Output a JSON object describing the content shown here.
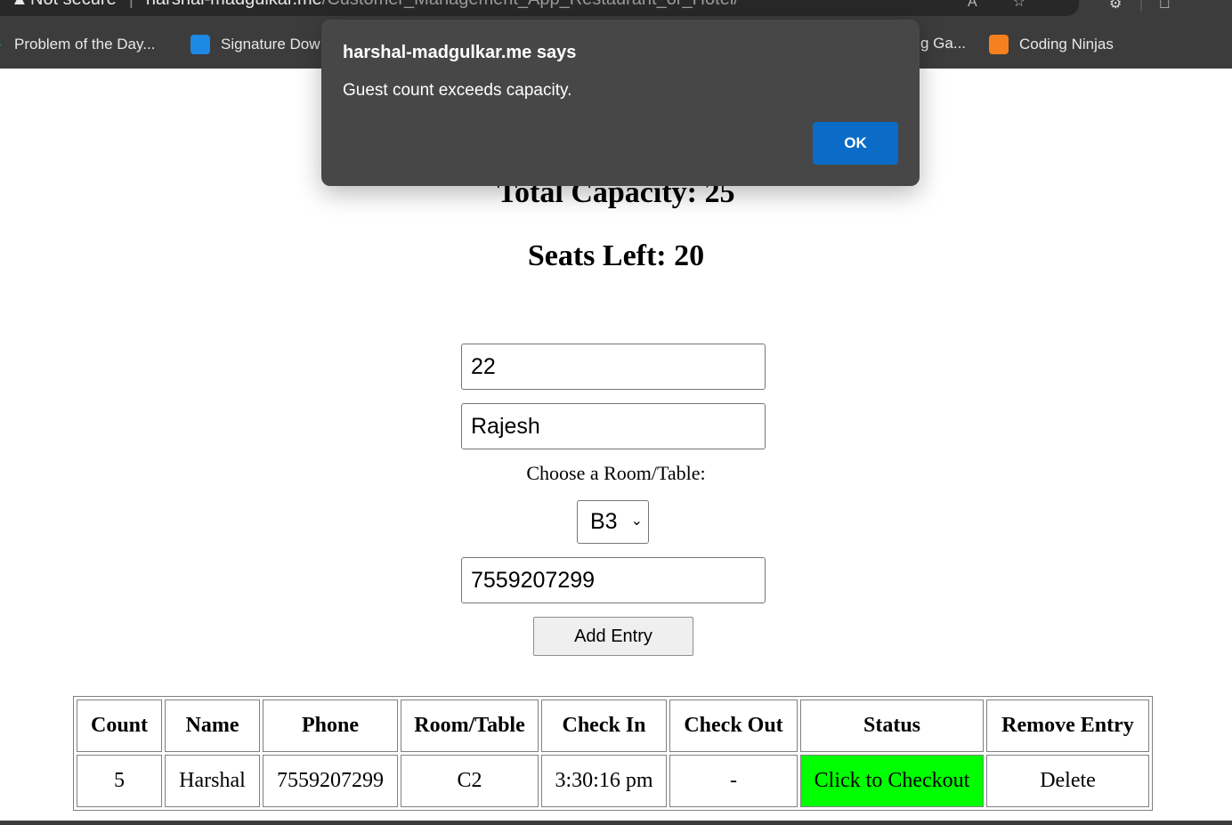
{
  "browser": {
    "security_label": "Not secure",
    "url_host": "harshal-madgulkar.me",
    "url_path": "/Customer_Management_App_Restaurant_or_Hotel/",
    "bookmarks": [
      {
        "label": "Problem of the Day..."
      },
      {
        "label": "Signature Dow"
      },
      {
        "label": "g Ga..."
      },
      {
        "label": "Coding Ninjas"
      }
    ]
  },
  "page": {
    "total_capacity_text": "Total Capacity: 25",
    "seats_left_text": "Seats Left: 20",
    "form": {
      "guest_count_value": "22",
      "name_value": "Rajesh",
      "room_label": "Choose a Room/Table:",
      "room_selected": "B3",
      "phone_value": "7559207299",
      "add_button_label": "Add Entry"
    },
    "table": {
      "headers": [
        "Count",
        "Name",
        "Phone",
        "Room/Table",
        "Check In",
        "Check Out",
        "Status",
        "Remove Entry"
      ],
      "rows": [
        {
          "count": "5",
          "name": "Harshal",
          "phone": "7559207299",
          "room": "C2",
          "check_in": "3:30:16 pm",
          "check_out": "-",
          "status": "Click to Checkout",
          "remove": "Delete"
        }
      ]
    }
  },
  "dialog": {
    "title": "harshal-madgulkar.me says",
    "message": "Guest count exceeds capacity.",
    "ok_label": "OK"
  },
  "colors": {
    "status_green": "#00ff00",
    "dialog_bg": "#474747",
    "ok_button": "#0b6cc8"
  }
}
